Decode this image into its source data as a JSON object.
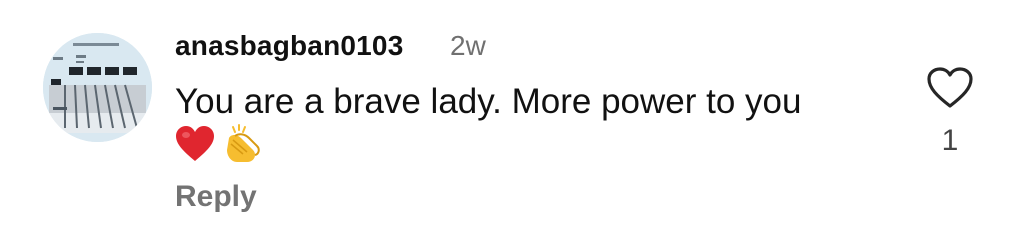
{
  "comment": {
    "username": "anasbagban0103",
    "timestamp": "2w",
    "text": "You are a brave lady. More power to you",
    "emojis": [
      "red-heart",
      "clapping-hands"
    ],
    "reply_label": "Reply",
    "like_count": "1"
  },
  "colors": {
    "username": "#111111",
    "timestamp": "#707070",
    "reply": "#737373",
    "heart_emoji": "#e0262f",
    "clap_emoji": "#f6bd30",
    "like_icon_stroke": "#262626"
  },
  "icons": {
    "like": "heart-outline-icon",
    "avatar": "profile-avatar"
  }
}
